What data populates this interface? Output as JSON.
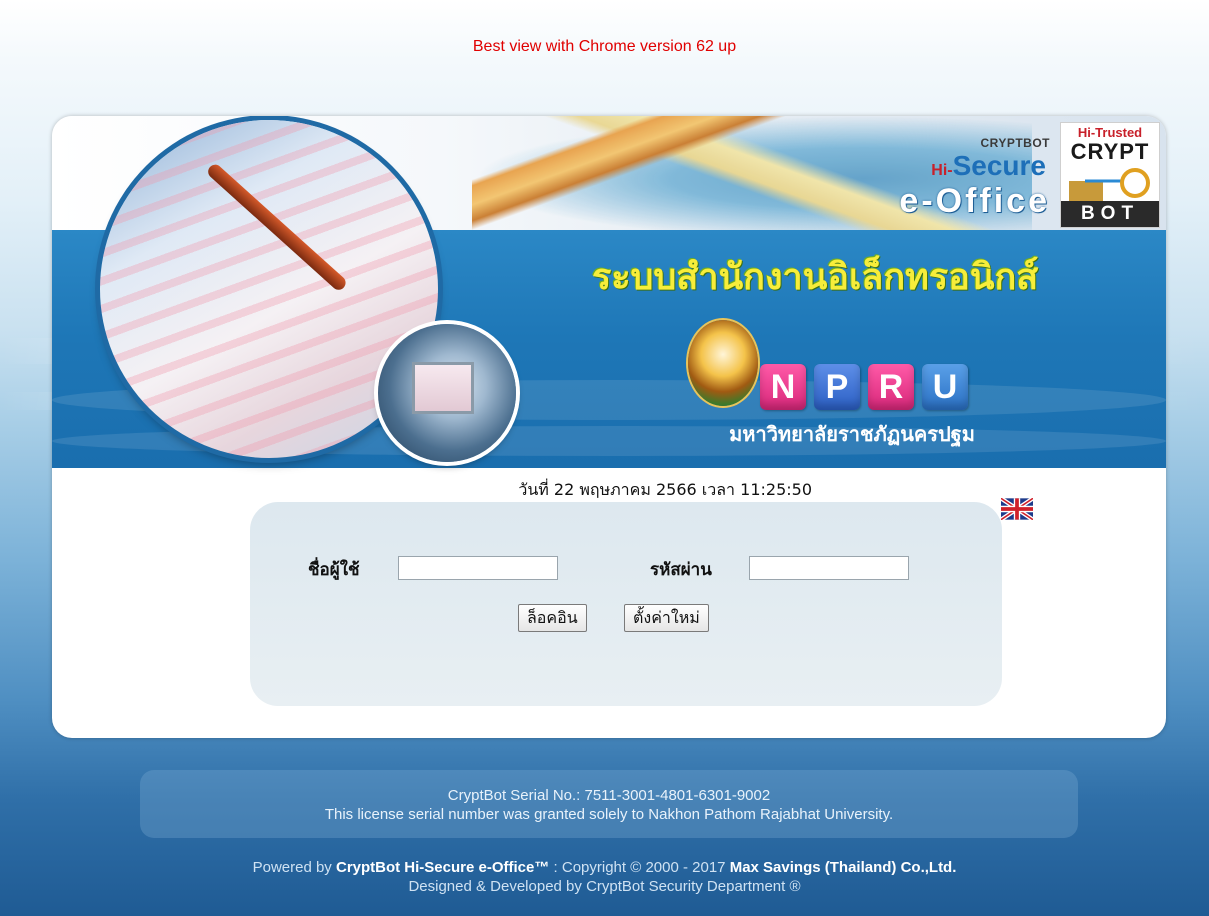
{
  "top_note": "Best view with Chrome version 62 up",
  "brand": {
    "cryptbot": "CRYPTBOT",
    "hi": "Hi-",
    "secure": "Secure",
    "eoffice": "e-Office",
    "badge_top": "Hi-Trusted",
    "badge_crypt": "CRYPT",
    "badge_bot": "BOT"
  },
  "system_title": "ระบบสำนักงานอิเล็กทรอนิกส์",
  "logo_letters": [
    "N",
    "P",
    "R",
    "U"
  ],
  "university_name": "มหาวิทยาลัยราชภัฏนครปฐม",
  "datetime": {
    "date": "วันที่ 22 พฤษภาคม 2566",
    "time_label": "เวลา",
    "time": "11:25:50"
  },
  "form": {
    "username_label": "ชื่อผู้ใช้",
    "username_value": "",
    "password_label": "รหัสผ่าน",
    "password_value": "",
    "login_button": "ล็อคอิน",
    "reset_button": "ตั้งค่าใหม่"
  },
  "license": {
    "line1": "CryptBot Serial No.: 7511-3001-4801-6301-9002",
    "line2": "This license serial number was granted solely to Nakhon Pathom Rajabhat University."
  },
  "footer": {
    "powered_prefix": "Powered by",
    "product": "CryptBot Hi-Secure e-Office™",
    "copyright": " : Copyright © 2000 - 2017",
    "company": "Max Savings (Thailand) Co.,Ltd.",
    "line2": "Designed & Developed by CryptBot Security Department ®"
  },
  "colors": {
    "note_red": "#e00000",
    "title_yellow": "#f7ed3a",
    "banner_blue": "#1e77b7",
    "npru_pink": "#d8277a",
    "npru_blue": "#2b5fc4"
  }
}
